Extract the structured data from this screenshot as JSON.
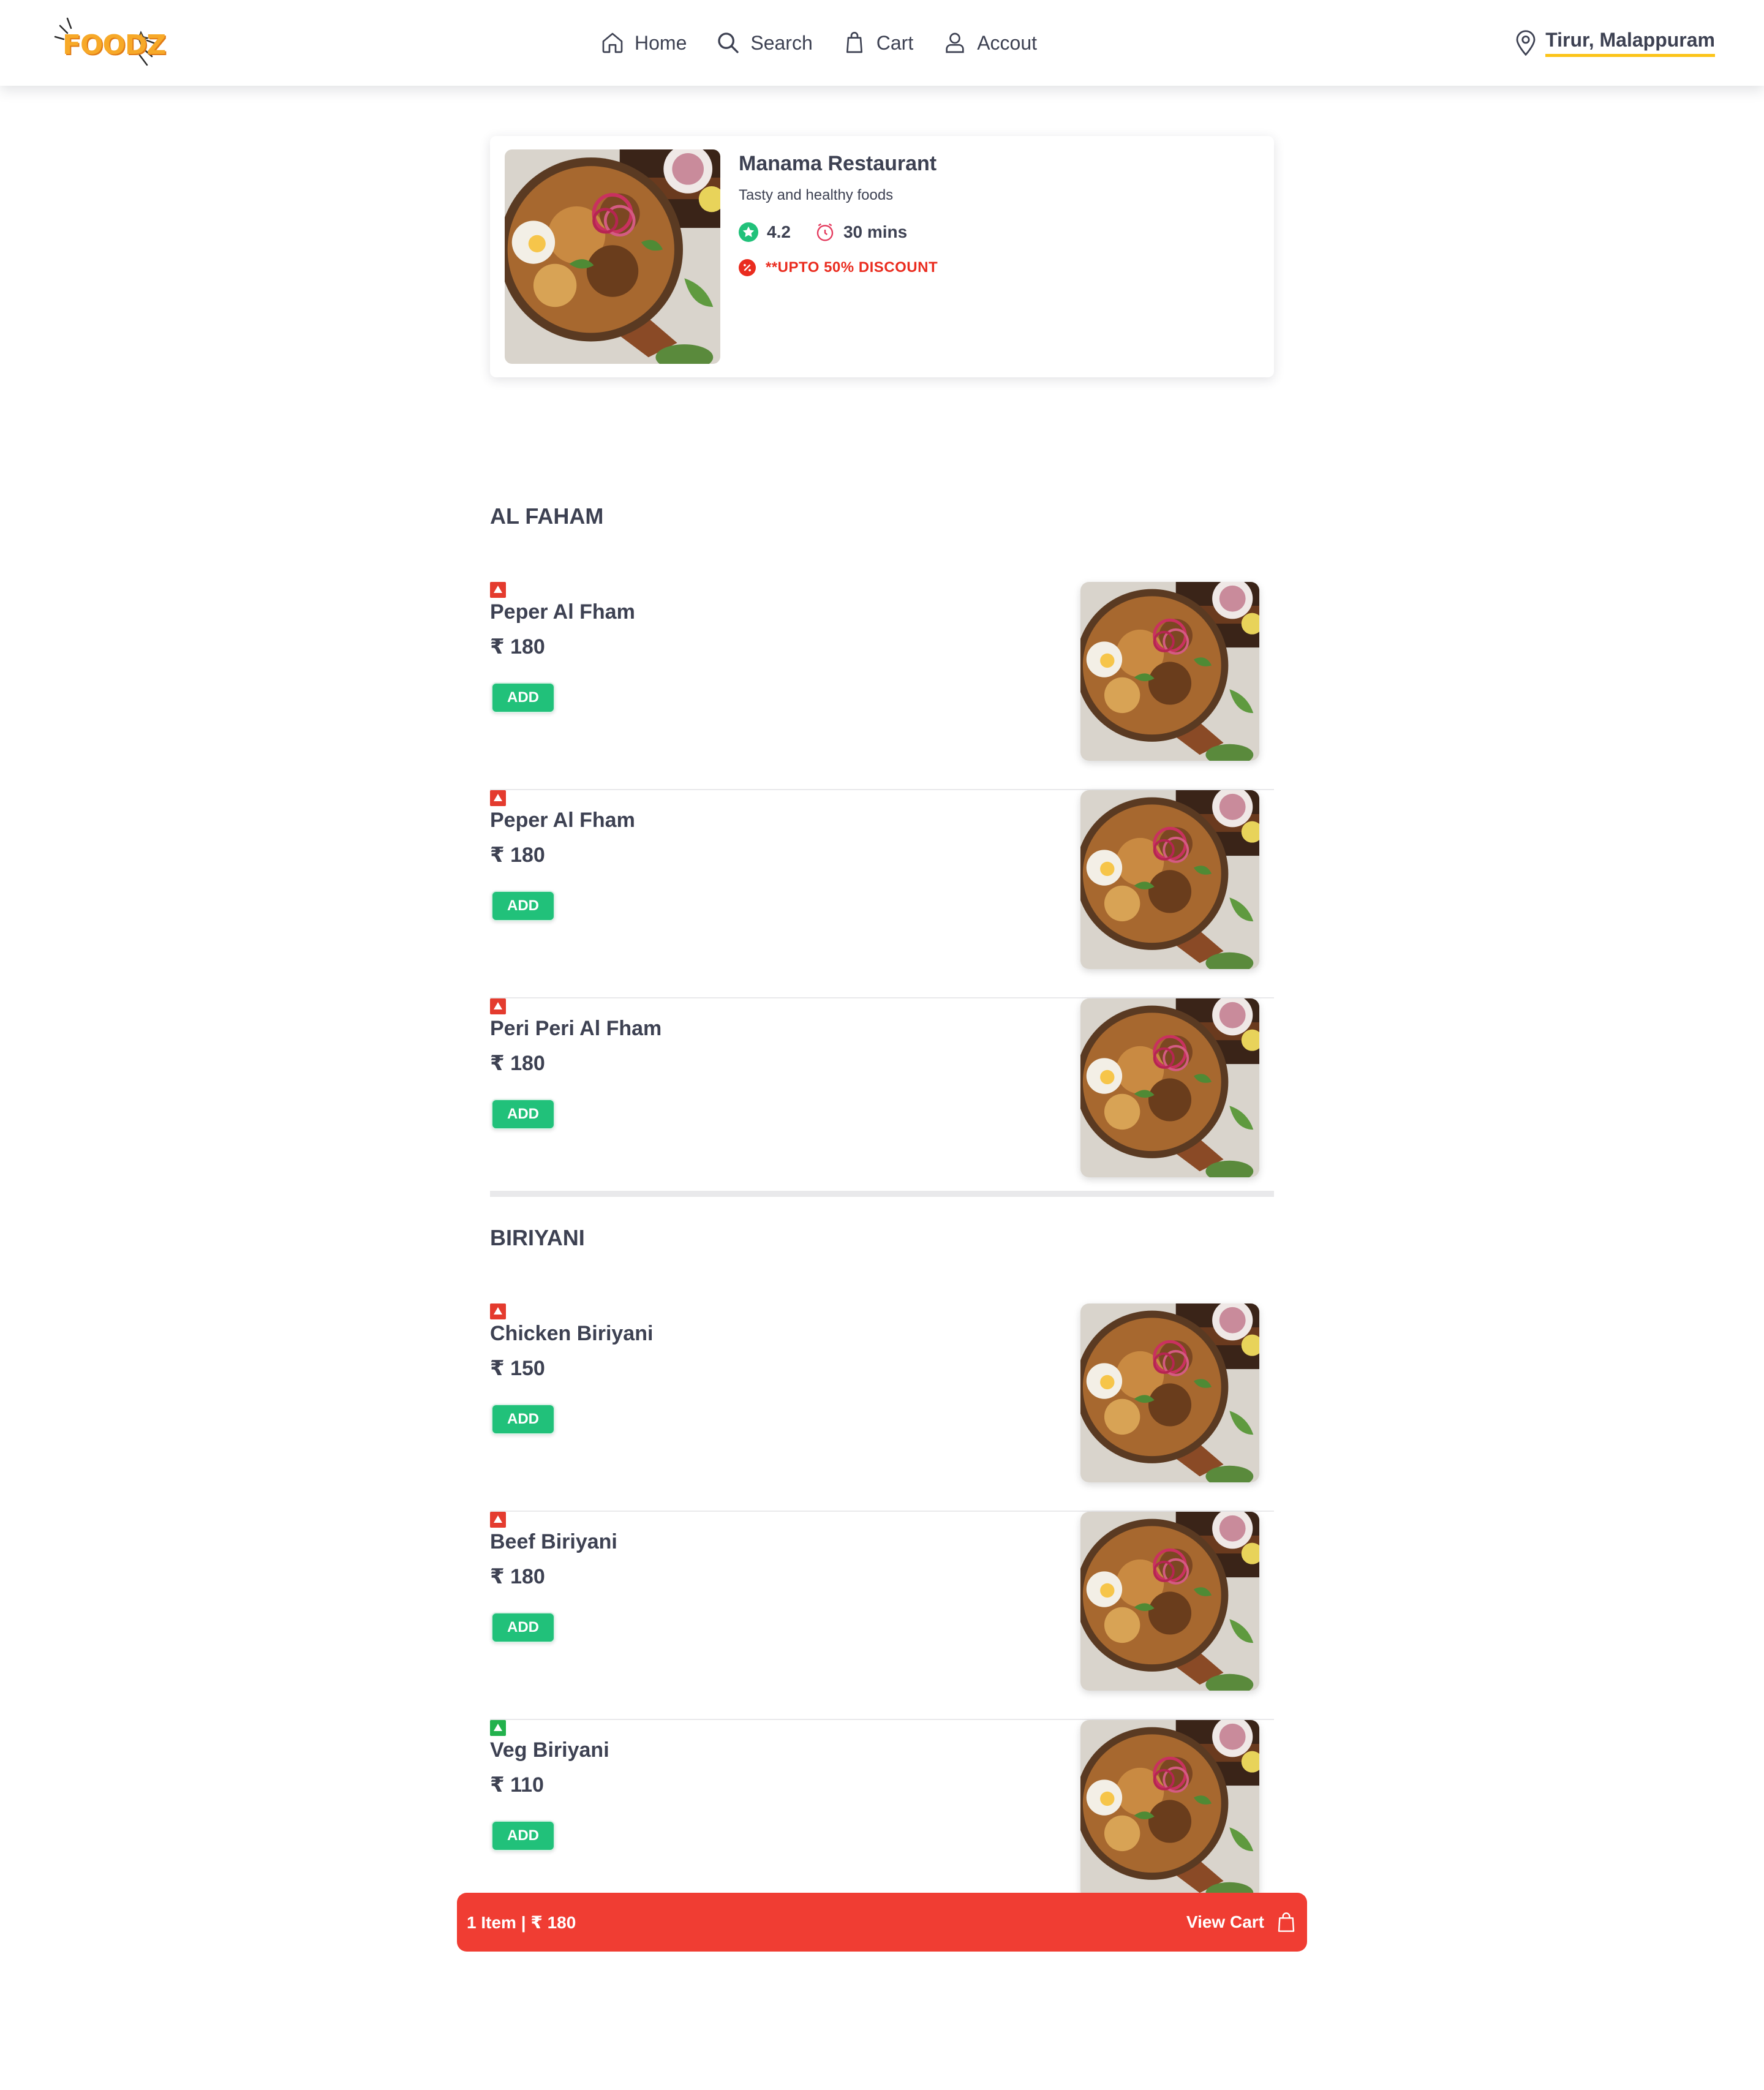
{
  "header": {
    "logo_text": "FOODZ",
    "nav": [
      {
        "label": "Home",
        "icon": "home-icon"
      },
      {
        "label": "Search",
        "icon": "search-icon"
      },
      {
        "label": "Cart",
        "icon": "bag-icon"
      },
      {
        "label": "Accout",
        "icon": "user-icon"
      }
    ],
    "location": "Tirur, Malappuram",
    "accent_color": "#fcc419"
  },
  "restaurant": {
    "name": "Manama Restaurant",
    "tagline": "Tasty and healthy foods",
    "rating": "4.2",
    "time": "30 mins",
    "discount": "**UPTO 50% DISCOUNT"
  },
  "sections": [
    {
      "title": "AL FAHAM",
      "items": [
        {
          "name": "Peper Al Fham",
          "price": "₹ 180",
          "veg": false,
          "add_label": "ADD"
        },
        {
          "name": "Peper Al Fham",
          "price": "₹ 180",
          "veg": false,
          "add_label": "ADD"
        },
        {
          "name": "Peri Peri Al Fham",
          "price": "₹ 180",
          "veg": false,
          "add_label": "ADD"
        }
      ]
    },
    {
      "title": "BIRIYANI",
      "items": [
        {
          "name": "Chicken Biriyani",
          "price": "₹ 150",
          "veg": false,
          "add_label": "ADD"
        },
        {
          "name": "Beef Biriyani",
          "price": "₹ 180",
          "veg": false,
          "add_label": "ADD"
        },
        {
          "name": "Veg Biriyani",
          "price": "₹ 110",
          "veg": true,
          "add_label": "ADD"
        }
      ]
    }
  ],
  "cart_bar": {
    "summary": "1 Item | ₹ 180",
    "action": "View Cart",
    "color": "#f03d33"
  },
  "colors": {
    "add_button": "#21c17a",
    "nonveg": "#e43b2e",
    "veg": "#22b14c",
    "discount": "#ea2c1f",
    "rating_icon": "#21c17a"
  }
}
